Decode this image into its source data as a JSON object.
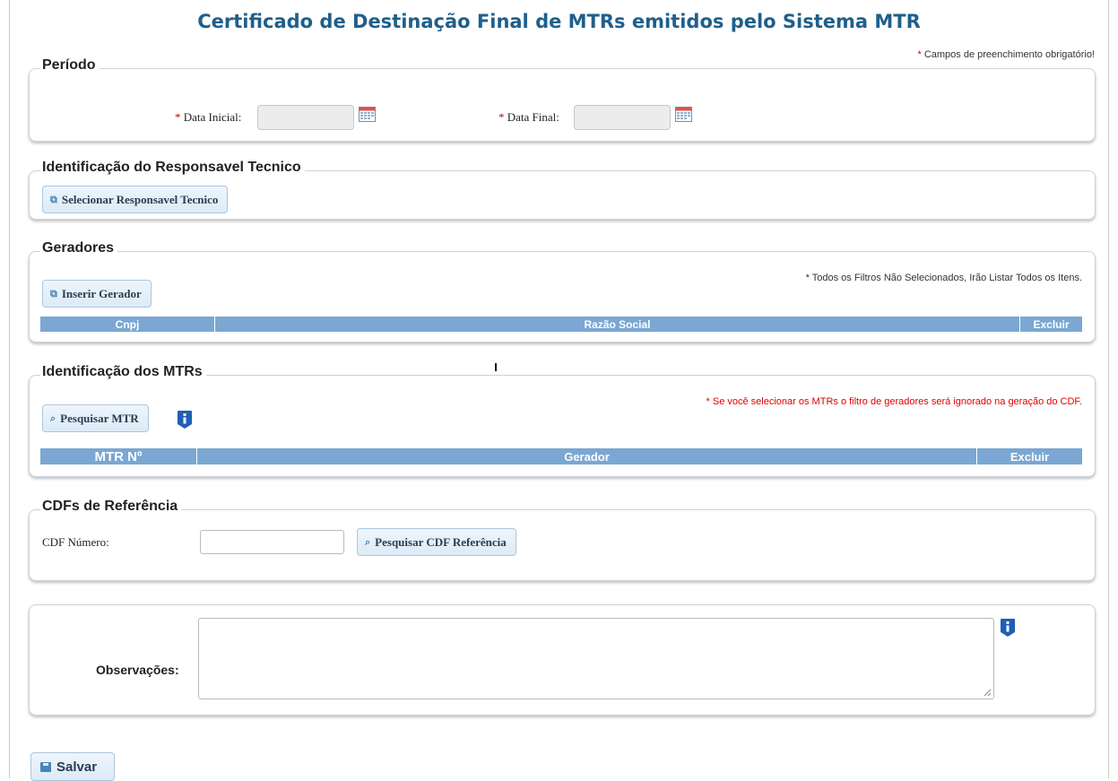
{
  "page": {
    "title": "Certificado de Destinação Final de MTRs emitidos pelo Sistema MTR",
    "required_star": "*",
    "required_note": "Campos de preenchimento obrigatório!"
  },
  "periodo": {
    "legend": "Período",
    "data_inicial_label": "Data Inicial:",
    "data_final_label": "Data Final:",
    "data_inicial_value": "",
    "data_final_value": ""
  },
  "responsavel": {
    "legend": "Identificação do Responsavel Tecnico",
    "button_label": "Selecionar Responsavel Tecnico"
  },
  "geradores": {
    "legend": "Geradores",
    "note": "* Todos os Filtros Não Selecionados, Irão Listar Todos os Itens.",
    "button_label": "Inserir Gerador",
    "columns": [
      "Cnpj",
      "Razão Social",
      "Excluir"
    ]
  },
  "mtrs": {
    "legend": "Identificação dos MTRs",
    "note": "* Se você selecionar os MTRs o filtro de geradores será ignorado na geração do CDF.",
    "button_label": "Pesquisar MTR",
    "columns": [
      "MTR Nº",
      "Gerador",
      "Excluir"
    ]
  },
  "cdfs": {
    "legend": "CDFs de Referência",
    "numero_label": "CDF Número:",
    "numero_value": "",
    "button_label": "Pesquisar CDF Referência"
  },
  "observacoes": {
    "label": "Observações:",
    "value": ""
  },
  "footer": {
    "save_label": "Salvar"
  },
  "colors": {
    "title": "#1f5f8b",
    "grid_header": "#7ba7d2",
    "required": "#d00000",
    "red_note": "#e00000",
    "button_bg": "#dcebf7"
  }
}
